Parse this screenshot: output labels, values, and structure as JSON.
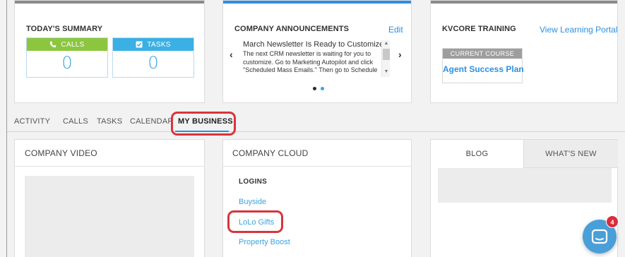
{
  "summary": {
    "title": "TODAY'S SUMMARY",
    "calls": {
      "label": "CALLS",
      "value": "0",
      "icon": "phone-icon"
    },
    "tasks": {
      "label": "TASKS",
      "value": "0",
      "icon": "checkbox-icon"
    }
  },
  "announcements": {
    "title": "COMPANY ANNOUNCEMENTS",
    "edit_label": "Edit",
    "headline": "March Newsletter Is Ready to Customize",
    "body_lines": [
      "The next CRM newsletter is waiting for you to",
      "customize. Go to Marketing Autopilot and click",
      "\"Scheduled Mass Emails.\" Then go to Schedule"
    ]
  },
  "training": {
    "title": "KVCORE TRAINING",
    "portal_link": "View Learning Portal",
    "current_course_label": "CURRENT COURSE",
    "course_name": "Agent Success Plan"
  },
  "tabs": [
    "ACTIVITY",
    "CALLS",
    "TASKS",
    "CALENDAR",
    "MY BUSINESS"
  ],
  "active_tab": "MY BUSINESS",
  "video": {
    "title": "COMPANY VIDEO"
  },
  "cloud": {
    "title": "COMPANY CLOUD",
    "logins_label": "LOGINS",
    "links": [
      "Buyside",
      "LoLo Gifts",
      "Property Boost"
    ]
  },
  "blog": {
    "tabs": [
      "BLOG",
      "WHAT'S NEW"
    ]
  },
  "chat": {
    "badge_count": "4"
  },
  "colors": {
    "accent_blue": "#2e8fe0",
    "calls_green": "#8cc63f",
    "tasks_blue": "#3ab0e4",
    "highlight_red": "#d9343d"
  }
}
